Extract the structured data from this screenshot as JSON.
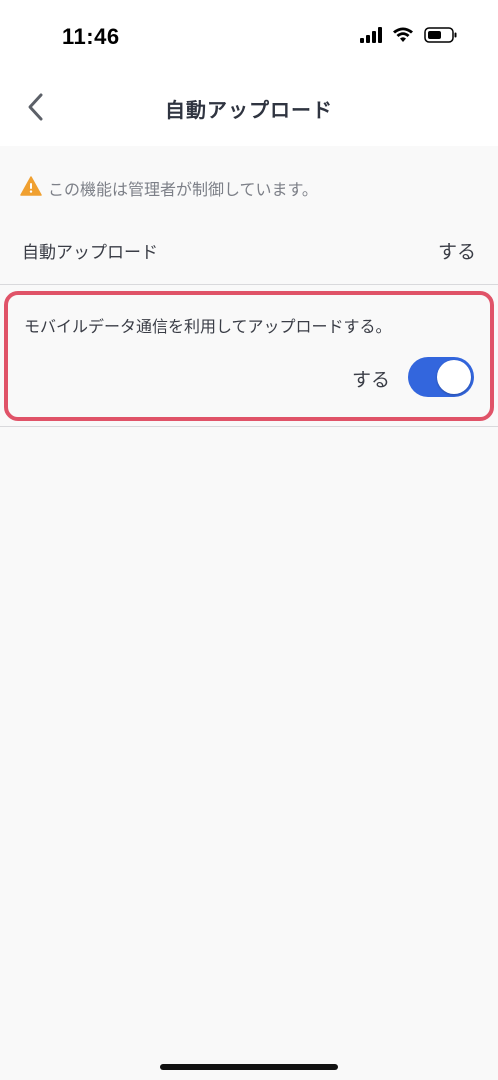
{
  "status_bar": {
    "time": "11:46",
    "icons": [
      "cellular-signal-icon",
      "wifi-icon",
      "battery-icon"
    ]
  },
  "nav": {
    "back_icon": "chevron-left-icon",
    "title": "自動アップロード"
  },
  "notice": {
    "icon": "warning-icon",
    "text": "この機能は管理者が制御しています。",
    "icon_color": "#f0a030"
  },
  "auto_upload": {
    "label": "自動アップロード",
    "value": "する"
  },
  "mobile_data": {
    "label": "モバイルデータ通信を利用してアップロードする。",
    "value": "する",
    "toggle_on": true,
    "toggle_color": "#3366dd",
    "highlight_color": "#e05368"
  }
}
